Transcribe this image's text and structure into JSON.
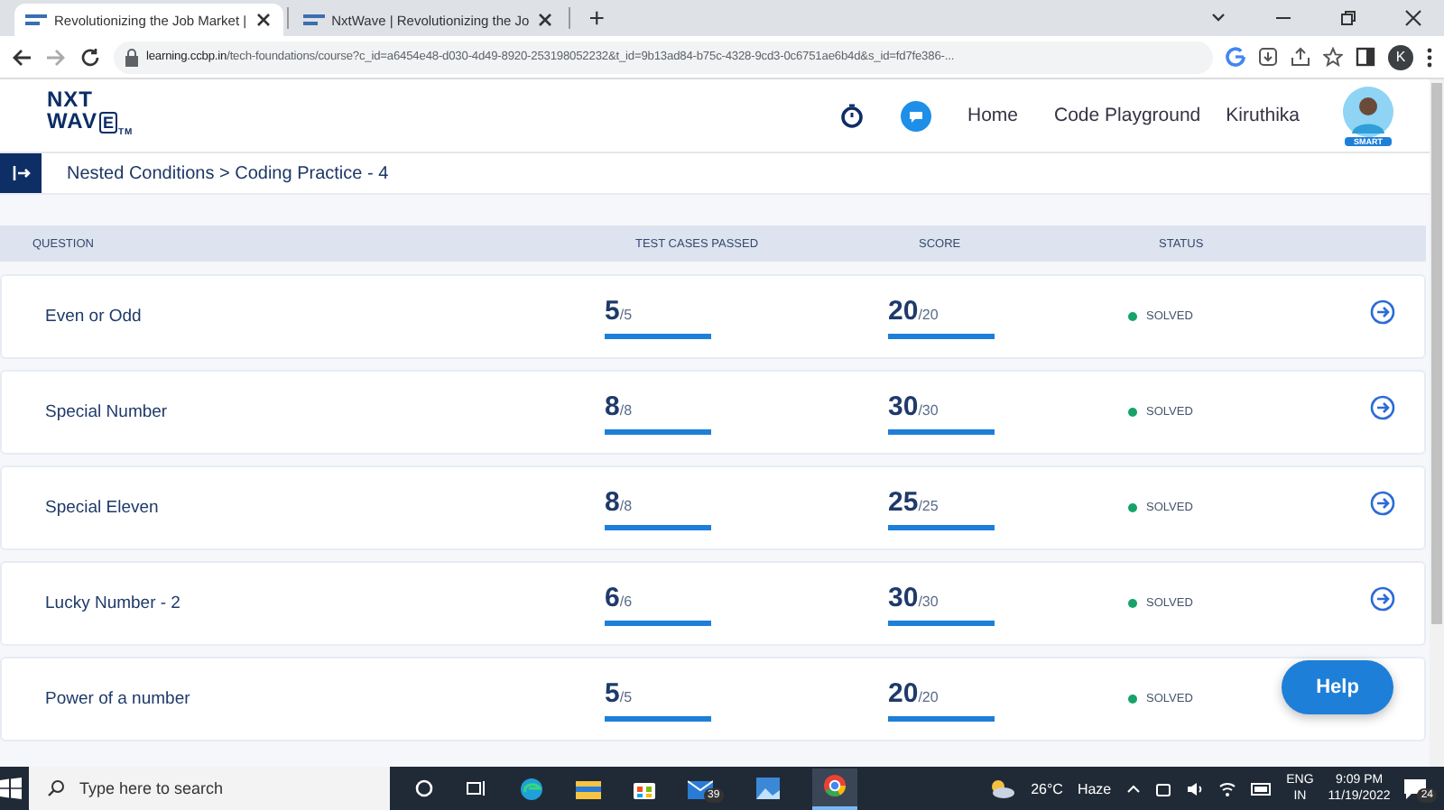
{
  "browser": {
    "tabs": [
      {
        "title": "Revolutionizing the Job Market |",
        "selected": true
      },
      {
        "title": "NxtWave | Revolutionizing the Jo",
        "selected": false
      }
    ],
    "new_tab": "+",
    "url_host": "learning.ccbp.in",
    "url_path": "/tech-foundations/course?c_id=a6454e48-d030-4d49-8920-253198052232&t_id=9b13ad84-b75c-4328-9cd3-0c6751ae6b4d&s_id=fd7fe386-...",
    "profile": "K"
  },
  "header": {
    "logo": {
      "line1": "NXT",
      "line2": "WAV",
      "boxed": "E",
      "mark": "TM"
    },
    "nav": [
      "Home",
      "Code Playground"
    ],
    "user": "Kiruthika",
    "badge": "SMART"
  },
  "breadcrumb": "Nested Conditions > Coding Practice - 4",
  "table": {
    "columns": [
      "QUESTION",
      "TEST CASES PASSED",
      "SCORE",
      "STATUS"
    ],
    "rows": [
      {
        "question": "Even or Odd",
        "passed": {
          "count": "5",
          "total": "/5",
          "level": 1
        },
        "score": {
          "count": "20",
          "total": "/20",
          "level": 1
        },
        "status": "SOLVED",
        "arrow_covered": false
      },
      {
        "question": "Special Number",
        "passed": {
          "count": "8",
          "total": "/8",
          "level": 1
        },
        "score": {
          "count": "30",
          "total": "/30",
          "level": 1
        },
        "status": "SOLVED",
        "arrow_covered": false
      },
      {
        "question": "Special Eleven",
        "passed": {
          "count": "8",
          "total": "/8",
          "level": 1
        },
        "score": {
          "count": "25",
          "total": "/25",
          "level": 1
        },
        "status": "SOLVED",
        "arrow_covered": false
      },
      {
        "question": "Lucky Number - 2",
        "passed": {
          "count": "6",
          "total": "/6",
          "level": 1
        },
        "score": {
          "count": "30",
          "total": "/30",
          "level": 1
        },
        "status": "SOLVED",
        "arrow_covered": false
      },
      {
        "question": "Power of a number",
        "passed": {
          "count": "5",
          "total": "/5",
          "level": 1
        },
        "score": {
          "count": "20",
          "total": "/20",
          "level": 1
        },
        "status": "SOLVED",
        "arrow_covered": true
      }
    ]
  },
  "help_button": "Help",
  "taskbar": {
    "search_placeholder": "Type here to search",
    "mail_count": "39",
    "temperature": "26°C",
    "weather": "Haze",
    "language": "ENG",
    "region": "IN",
    "time": "9:09 PM",
    "date": "11/19/2022",
    "notifications": "24"
  }
}
